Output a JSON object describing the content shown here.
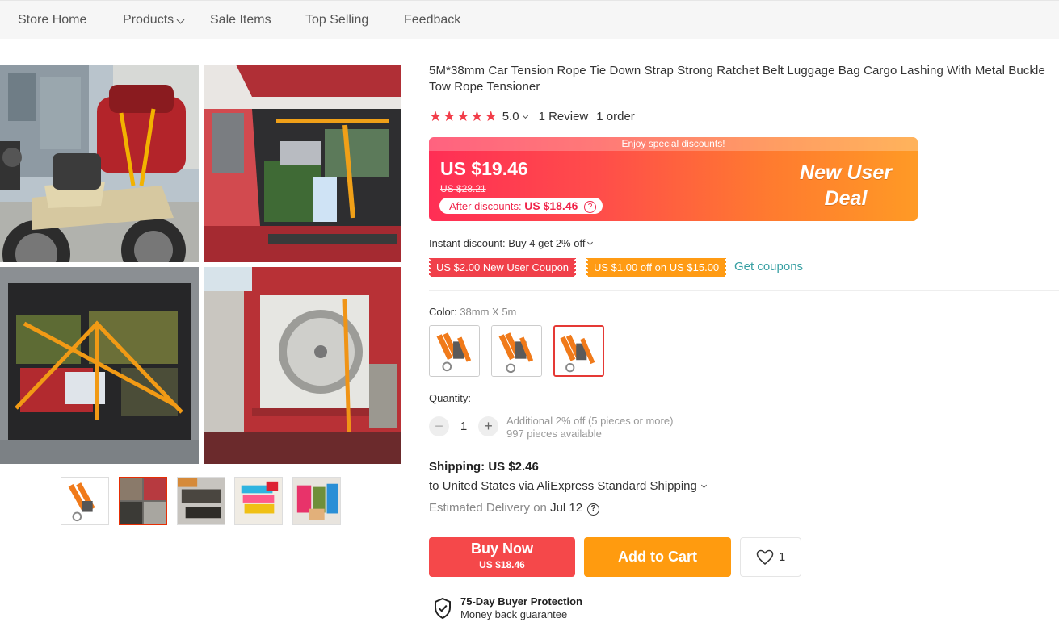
{
  "nav": {
    "items": [
      "Store Home",
      "Products",
      "Sale Items",
      "Top Selling",
      "Feedback"
    ]
  },
  "product": {
    "title": "5M*38mm Car Tension Rope Tie Down Strap Strong Ratchet Belt Luggage Bag Cargo Lashing With Metal Buckle Tow Rope Tensioner",
    "rating": "5.0",
    "stars": 5,
    "reviews": "1 Review",
    "orders": "1 order"
  },
  "price": {
    "banner_text": "Enjoy special discounts!",
    "current": "US $19.46",
    "original": "US $28.21",
    "after_label": "After discounts:",
    "after_value": "US $18.46",
    "deal_line1": "New User",
    "deal_line2": "Deal",
    "colors": {
      "red": "#ff2e55",
      "orange": "#ff9a25"
    }
  },
  "discounts": {
    "instant": "Instant discount: Buy 4 get 2% off",
    "coupon1": "US $2.00 New User Coupon",
    "coupon2": "US $1.00 off on US $15.00",
    "get_coupons": "Get coupons"
  },
  "color": {
    "label": "Color:",
    "selected": "38mm X 5m",
    "options": [
      "38mm strap variant 1",
      "38mm strap variant 2",
      "38mm X 5m"
    ]
  },
  "quantity": {
    "label": "Quantity:",
    "value": "1",
    "minus": "−",
    "plus": "+",
    "note1": "Additional 2% off (5 pieces or more)",
    "note2": "997 pieces available"
  },
  "shipping": {
    "title": "Shipping: US $2.46",
    "dest": "to United States via AliExpress Standard Shipping",
    "eta_label": "Estimated Delivery on",
    "eta_date": "Jul 12",
    "help": "?"
  },
  "actions": {
    "buy_now": "Buy Now",
    "buy_now_price": "US $18.46",
    "add_to_cart": "Add to Cart",
    "wishlist_count": "1"
  },
  "protection": {
    "title": "75-Day Buyer Protection",
    "subtitle": "Money back guarantee"
  }
}
